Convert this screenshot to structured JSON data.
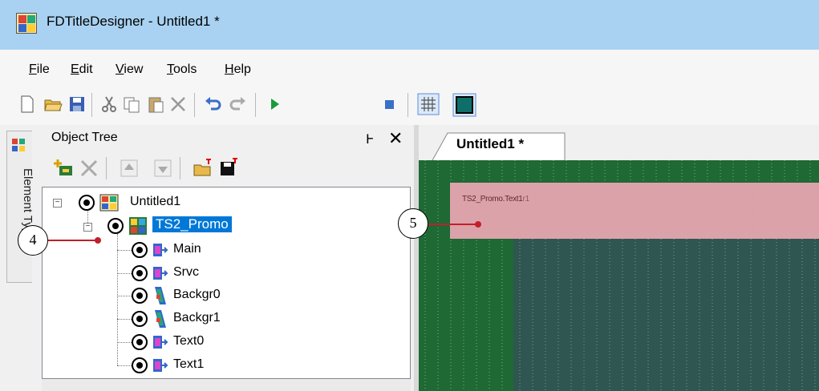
{
  "window": {
    "title": "FDTitleDesigner - Untitled1 *"
  },
  "menu": {
    "items": [
      "File",
      "Edit",
      "View",
      "Tools",
      "Help"
    ]
  },
  "toolbar": {
    "buttons": [
      "new-icon",
      "open-icon",
      "save-icon",
      "cut-icon",
      "copy-icon",
      "paste-icon",
      "delete-icon",
      "undo-icon",
      "redo-icon",
      "play-icon",
      "stop-icon",
      "grid-icon",
      "fill-icon"
    ]
  },
  "side_tab": {
    "label": "Element Types"
  },
  "object_tree": {
    "title": "Object Tree",
    "pin_glyph": "Ͱ",
    "close_glyph": "✕",
    "toolbar": [
      "add-object-icon",
      "delete-icon",
      "move-up-icon",
      "move-down-icon",
      "open-template-icon",
      "save-template-icon"
    ],
    "root": "Untitled1",
    "selected": "TS2_Promo",
    "children": [
      "Main",
      "Srvc",
      "Backgr0",
      "Backgr1",
      "Text0",
      "Text1"
    ]
  },
  "document": {
    "tab_label": "Untitled1 *",
    "canvas_label": "TS2_Promo.Text1",
    "canvas_label_overlap": "r1"
  },
  "callouts": {
    "left": "4",
    "right": "5"
  },
  "colors": {
    "titlebar": "#a9d2f2",
    "selection": "#0078d7",
    "canvas": "#1e6934",
    "overlay": "#e7a5b0",
    "leader": "#c0202a"
  }
}
